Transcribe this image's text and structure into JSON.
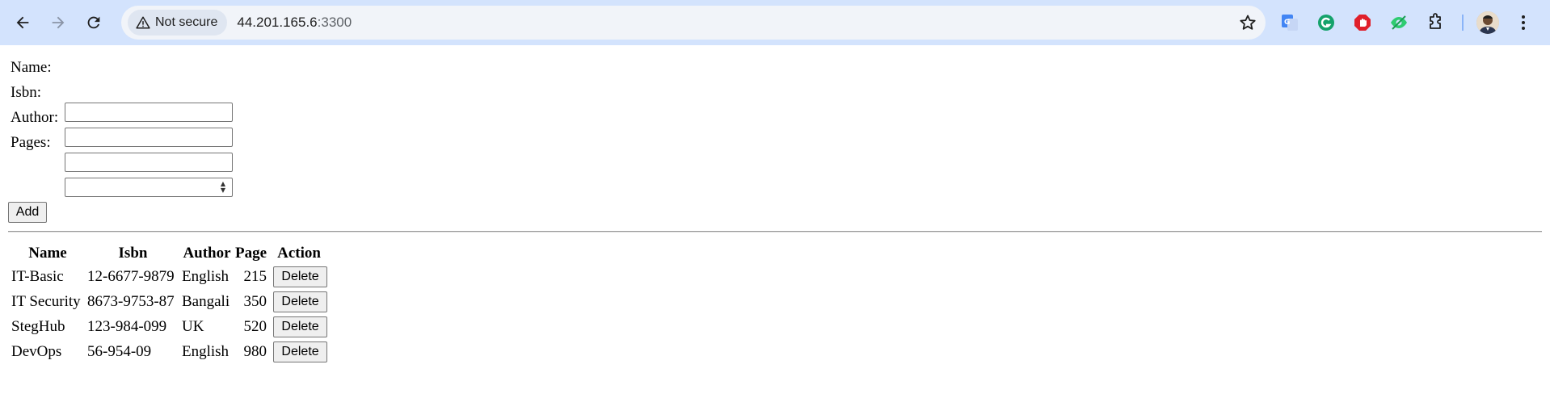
{
  "browser": {
    "security_label": "Not secure",
    "url_host": "44.201.165.6",
    "url_port": ":3300",
    "extensions": [
      "google-translate-icon",
      "grammarly-icon",
      "adblock-icon",
      "eye-extension-icon",
      "puzzle-icon"
    ],
    "accent_color": "#d3e3fd"
  },
  "form": {
    "name_label": "Name:",
    "isbn_label": "Isbn:",
    "author_label": "Author:",
    "pages_label": "Pages:",
    "name_value": "",
    "isbn_value": "",
    "author_value": "",
    "pages_value": "",
    "add_label": "Add"
  },
  "table": {
    "headers": [
      "Name",
      "Isbn",
      "Author",
      "Page",
      "Action"
    ],
    "rows": [
      {
        "name": "IT-Basic",
        "isbn": "12-6677-9879",
        "author": "English",
        "page": "215",
        "action": "Delete"
      },
      {
        "name": "IT Security",
        "isbn": "8673-9753-87",
        "author": "Bangali",
        "page": "350",
        "action": "Delete"
      },
      {
        "name": "StegHub",
        "isbn": "123-984-099",
        "author": "UK",
        "page": "520",
        "action": "Delete"
      },
      {
        "name": "DevOps",
        "isbn": "56-954-09",
        "author": "English",
        "page": "980",
        "action": "Delete"
      }
    ]
  }
}
